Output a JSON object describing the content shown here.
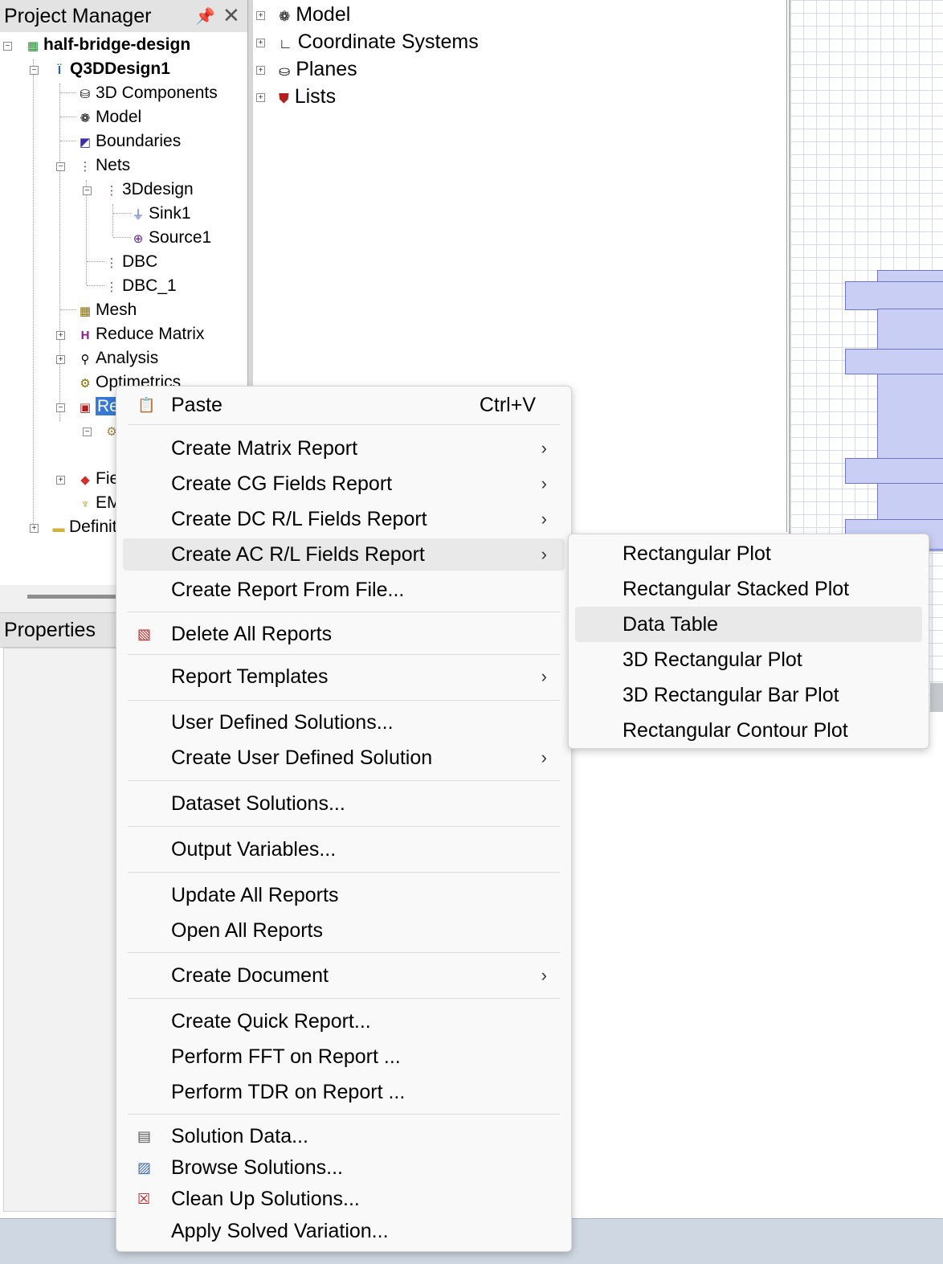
{
  "project_manager": {
    "title": "Project Manager",
    "tree": {
      "project": "half-bridge-design",
      "design": "Q3DDesign1",
      "items": {
        "components_3d": "3D Components",
        "model": "Model",
        "boundaries": "Boundaries",
        "nets": "Nets",
        "net_3ddesign": "3Ddesign",
        "sink1": "Sink1",
        "source1": "Source1",
        "dbc": "DBC",
        "dbc_1": "DBC_1",
        "mesh": "Mesh",
        "reduce_matrix": "Reduce Matrix",
        "analysis": "Analysis",
        "optimetrics": "Optimetrics",
        "results_partial": "Re",
        "fields_partial": "Fie",
        "em_partial": "EM",
        "definitions_partial": "Definit"
      }
    }
  },
  "properties": {
    "title": "Properties"
  },
  "model_tree": {
    "items": [
      "Model",
      "Coordinate Systems",
      "Planes",
      "Lists"
    ]
  },
  "context_menu": {
    "paste": {
      "label": "Paste",
      "shortcut": "Ctrl+V"
    },
    "create_matrix_report": "Create Matrix Report",
    "create_cg_fields_report": "Create CG Fields Report",
    "create_dc_rl_fields_report": "Create DC R/L Fields Report",
    "create_ac_rl_fields_report": "Create AC R/L Fields Report",
    "create_report_from_file": "Create Report From File...",
    "delete_all_reports": "Delete All Reports",
    "report_templates": "Report Templates",
    "user_defined_solutions": "User Defined Solutions...",
    "create_user_defined_solution": "Create User Defined Solution",
    "dataset_solutions": "Dataset Solutions...",
    "output_variables": "Output Variables...",
    "update_all_reports": "Update All Reports",
    "open_all_reports": "Open All Reports",
    "create_document": "Create Document",
    "create_quick_report": "Create Quick Report...",
    "perform_fft": "Perform FFT on Report ...",
    "perform_tdr": "Perform TDR on Report ...",
    "solution_data": "Solution Data...",
    "browse_solutions": "Browse Solutions...",
    "clean_up_solutions": "Clean Up Solutions...",
    "apply_solved_variation": "Apply Solved Variation..."
  },
  "submenu": {
    "items": [
      "Rectangular Plot",
      "Rectangular Stacked Plot",
      "Data Table",
      "3D Rectangular Plot",
      "3D Rectangular Bar Plot",
      "Rectangular Contour Plot"
    ],
    "highlighted": "Data Table"
  },
  "colors": {
    "selection": "#3779d6",
    "menu_bg": "#f9f9f9",
    "menu_hover": "#e9e9e9",
    "model_body": "#c9cef5"
  }
}
